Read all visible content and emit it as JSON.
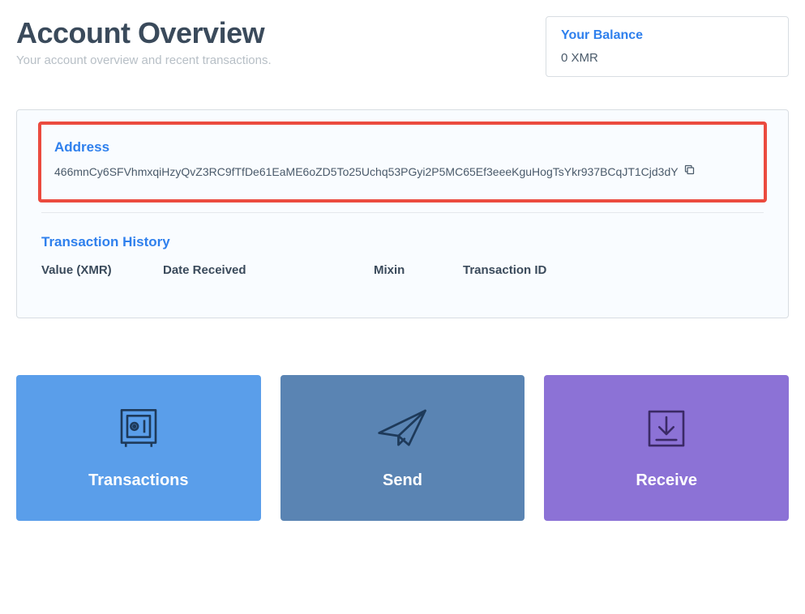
{
  "header": {
    "title": "Account Overview",
    "subtitle": "Your account overview and recent transactions."
  },
  "balance": {
    "label": "Your Balance",
    "value": "0 XMR"
  },
  "address": {
    "label": "Address",
    "value": "466mnCy6SFVhmxqiHzyQvZ3RC9fTfDe61EaME6oZD5To25Uchq53PGyi2P5MC65Ef3eeeKguHogTsYkr937BCqJT1Cjd3dY"
  },
  "history": {
    "label": "Transaction History",
    "columns": {
      "value": "Value (XMR)",
      "date": "Date Received",
      "mixin": "Mixin",
      "txid": "Transaction ID"
    }
  },
  "cards": {
    "transactions": "Transactions",
    "send": "Send",
    "receive": "Receive"
  }
}
